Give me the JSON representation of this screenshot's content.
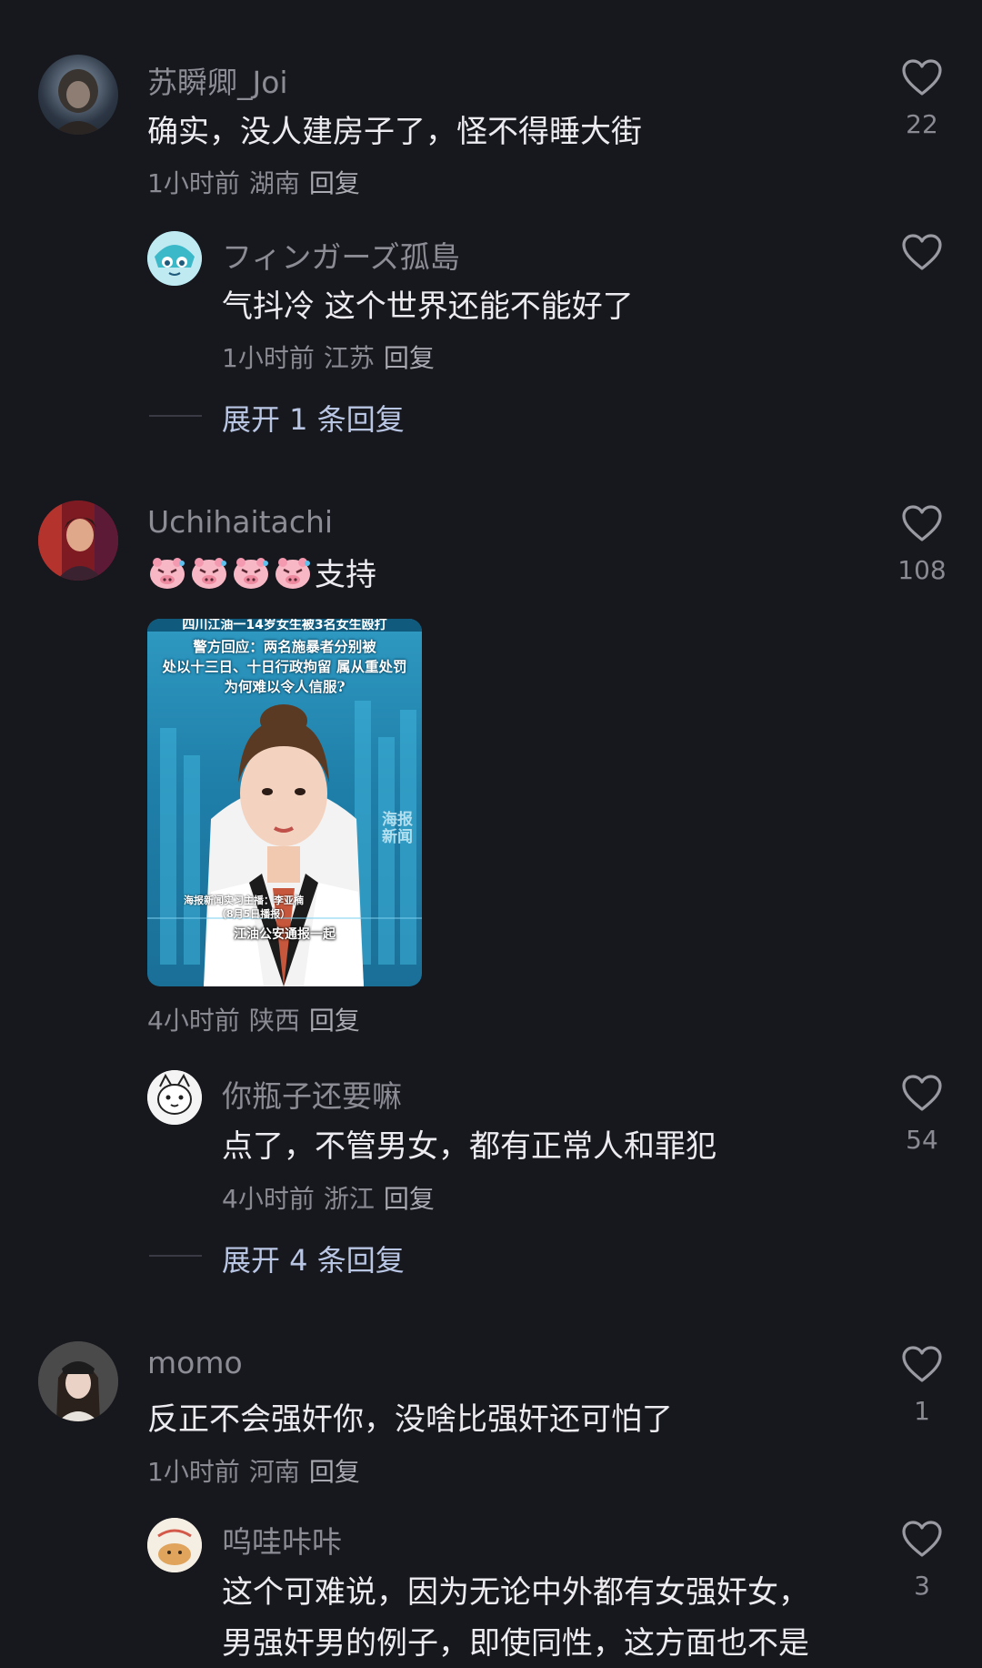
{
  "comments": [
    {
      "user": "苏瞬卿_Joi",
      "text": "确实，没人建房子了，怪不得睡大街",
      "time": "1小时前",
      "location": "湖南",
      "reply_label": "回复",
      "likes": "22",
      "replies": [
        {
          "user": "フィンガーズ孤島",
          "text": "气抖冷 这个世界还能不能好了",
          "time": "1小时前",
          "location": "江苏",
          "reply_label": "回复",
          "likes": ""
        }
      ],
      "expand_label": "展开 1 条回复"
    },
    {
      "user": "Uchihaitachi",
      "text": "支持",
      "emoji_icon": "pig-face-emoji-icon",
      "emoji_count": 4,
      "time": "4小时前",
      "location": "陕西",
      "reply_label": "回复",
      "likes": "108",
      "image": {
        "headline_top": "四川江油一14岁女生被3名女生殴打",
        "headline_1": "警方回应：两名施暴者分别被",
        "headline_2": "处以十三日、十日行政拘留 属从重处罚",
        "headline_3": "为何难以令人信服?",
        "watermark": "海报新闻",
        "caption_name": "海报新闻实习主播：李亚楠",
        "caption_date": "（8月5日播报）",
        "caption_sub": "江油公安通报一起"
      },
      "replies": [
        {
          "user": "你瓶子还要嘛",
          "text": "点了，不管男女，都有正常人和罪犯",
          "time": "4小时前",
          "location": "浙江",
          "reply_label": "回复",
          "likes": "54"
        }
      ],
      "expand_label": "展开 4 条回复"
    },
    {
      "user": "momo",
      "text": "反正不会强奸你，没啥比强奸还可怕了",
      "time": "1小时前",
      "location": "河南",
      "reply_label": "回复",
      "likes": "1",
      "replies": [
        {
          "user": "呜哇咔咔",
          "text_line1": "这个可难说，因为无论中外都有女强奸女，",
          "text_line2": "男强奸男的例子，即使同性，这方面也不是",
          "likes": "3"
        }
      ]
    }
  ]
}
